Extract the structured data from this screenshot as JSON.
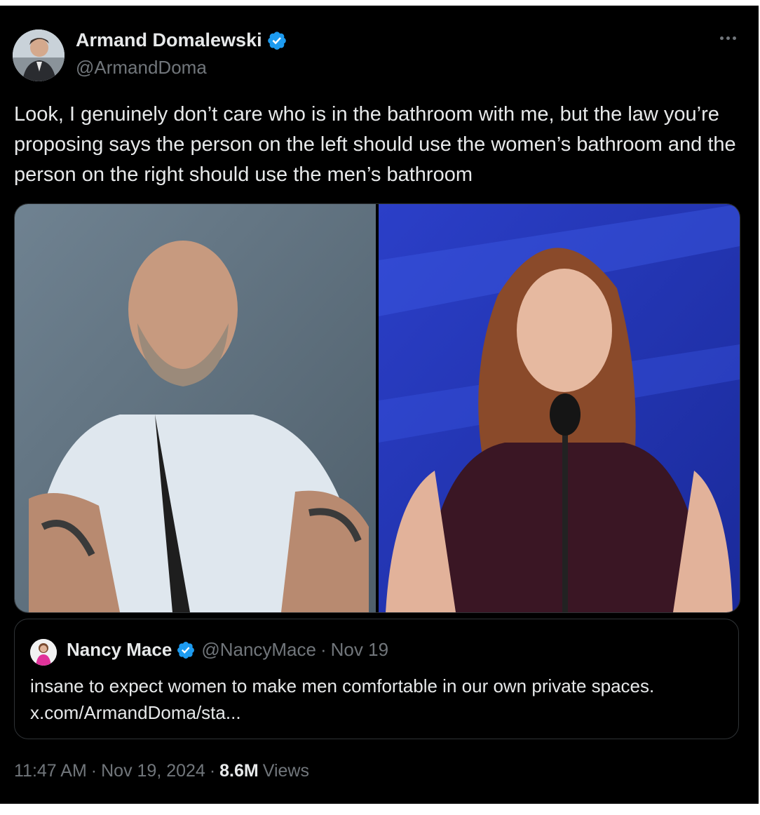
{
  "author": {
    "name": "Armand Domalewski",
    "handle": "@ArmandDoma"
  },
  "tweet": {
    "text": "Look, I genuinely don’t care who is in the bathroom with me, but the law you’re proposing says the person on the left should use the women’s bathroom and the person on the right should use the men’s bathroom"
  },
  "quote": {
    "name": "Nancy Mace",
    "handle": "@NancyMace",
    "separator": "·",
    "date": "Nov 19",
    "text_line1": "insane to expect women to make men comfortable in our own private spaces.",
    "text_line2": "x.com/ArmandDoma/sta..."
  },
  "footer": {
    "time": "11:47 AM",
    "sep1": "·",
    "date": "Nov 19, 2024",
    "sep2": "·",
    "views_count": "8.6M",
    "views_label": "Views"
  },
  "colors": {
    "background": "#000000",
    "text": "#e7e9ea",
    "muted": "#71767b",
    "verified": "#1d9bf0",
    "border": "#2f3336"
  },
  "icons": [
    "verified-badge-icon",
    "more-options-icon"
  ]
}
